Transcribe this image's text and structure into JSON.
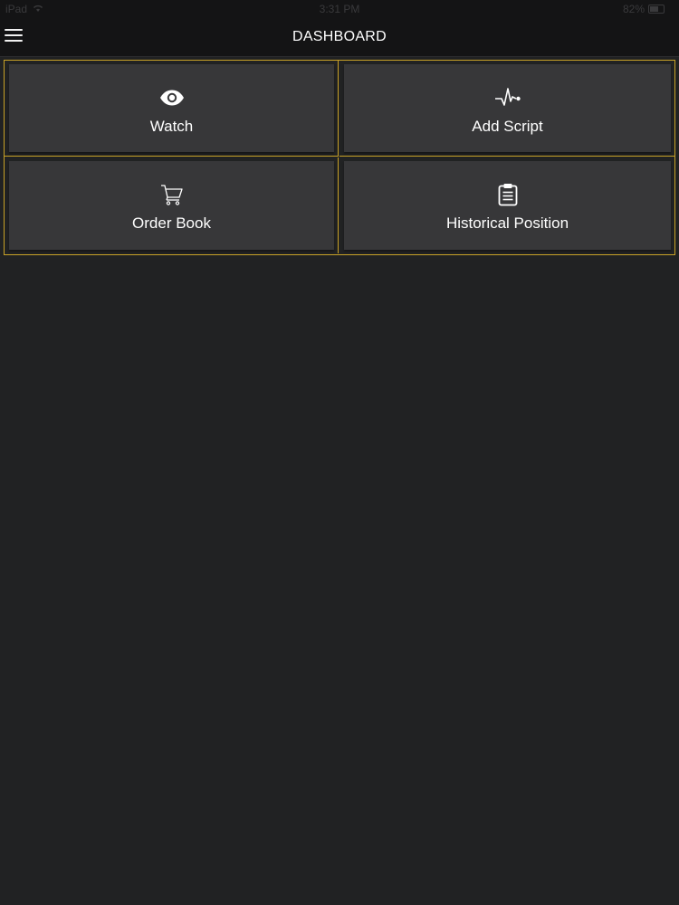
{
  "status_bar": {
    "carrier": "iPad",
    "time": "3:31 PM",
    "battery": "82%"
  },
  "nav": {
    "title": "DASHBOARD",
    "menu_icon": "hamburger-menu-icon"
  },
  "tiles": [
    {
      "label": "Watch",
      "icon": "eye-icon"
    },
    {
      "label": "Add Script",
      "icon": "pulse-icon"
    },
    {
      "label": "Order Book",
      "icon": "cart-icon"
    },
    {
      "label": "Historical Position",
      "icon": "clipboard-icon"
    }
  ],
  "colors": {
    "background": "#212223",
    "tile": "#373739",
    "border_accent": "#c9a227",
    "text": "#ffffff"
  }
}
